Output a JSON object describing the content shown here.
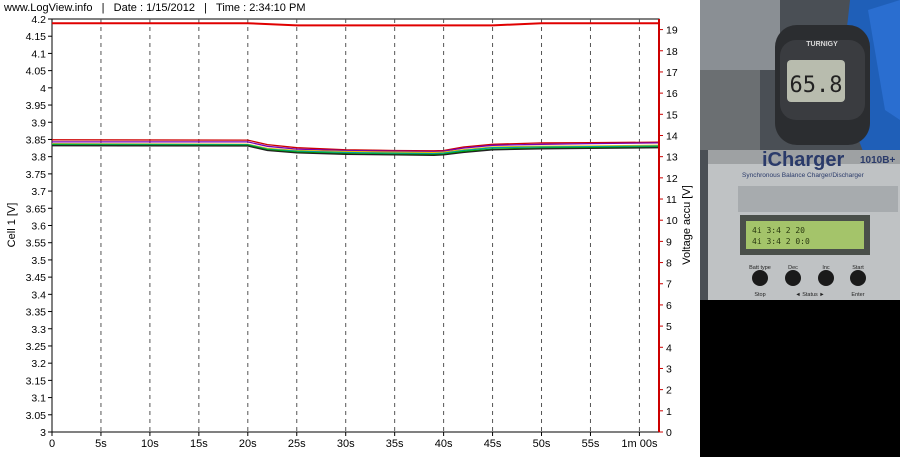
{
  "header": {
    "site": "www.LogView.info",
    "date": "Date : 1/15/2012",
    "time": "Time : 2:34:10 PM"
  },
  "photo": {
    "thermometer_brand": "TURNIGY",
    "thermometer_reading": "65.8",
    "charger_name": "iCharger",
    "charger_model": "1010B+",
    "charger_subtitle": "Synchronous Balance Charger/Discharger",
    "buttons": [
      "Batt type",
      "Dec",
      "Inc",
      "Start"
    ],
    "button_sublabels": [
      "Stop",
      "◄ Status ►",
      "Enter"
    ]
  },
  "chart_data": {
    "type": "line",
    "xlabel": "",
    "x_ticks": [
      "0",
      "5s",
      "10s",
      "15s",
      "20s",
      "25s",
      "30s",
      "35s",
      "40s",
      "45s",
      "50s",
      "55s",
      "1m 00s"
    ],
    "x_values": [
      0,
      5,
      10,
      15,
      20,
      25,
      30,
      35,
      40,
      45,
      50,
      55,
      60
    ],
    "xlim": [
      0,
      62
    ],
    "left_axis": {
      "label": "Cell 1 [V]",
      "ylim": [
        3.0,
        4.2
      ],
      "ticks": [
        "3",
        "3.05",
        "3.1",
        "3.15",
        "3.2",
        "3.25",
        "3.3",
        "3.35",
        "3.4",
        "3.45",
        "3.5",
        "3.55",
        "3.6",
        "3.65",
        "3.7",
        "3.75",
        "3.8",
        "3.85",
        "3.9",
        "3.95",
        "4",
        "4.05",
        "4.1",
        "4.15",
        "4.2"
      ]
    },
    "right_axis": {
      "label": "Voltage accu [V]",
      "ylim": [
        0,
        19.5
      ],
      "ticks": [
        "0",
        "1",
        "2",
        "3",
        "4",
        "5",
        "6",
        "7",
        "8",
        "9",
        "10",
        "11",
        "12",
        "13",
        "14",
        "15",
        "16",
        "17",
        "18",
        "19"
      ],
      "color": "#cc0000"
    },
    "grid": "vertical dashed",
    "series": [
      {
        "axis": "right",
        "color": "#e00000",
        "x": [
          0,
          20,
          25,
          30,
          35,
          40,
          45,
          50,
          55,
          62
        ],
        "y": [
          19.3,
          19.3,
          19.2,
          19.2,
          19.2,
          19.2,
          19.2,
          19.3,
          19.3,
          19.3
        ]
      },
      {
        "axis": "left",
        "color": "#cc0000",
        "x": [
          0,
          20,
          22,
          25,
          30,
          35,
          39,
          40,
          42,
          45,
          50,
          55,
          62
        ],
        "y": [
          3.849,
          3.848,
          3.835,
          3.826,
          3.82,
          3.818,
          3.817,
          3.818,
          3.828,
          3.836,
          3.84,
          3.841,
          3.842
        ]
      },
      {
        "axis": "left",
        "color": "#7a00b0",
        "x": [
          0,
          20,
          22,
          25,
          30,
          35,
          39,
          40,
          42,
          45,
          50,
          55,
          62
        ],
        "y": [
          3.843,
          3.843,
          3.83,
          3.822,
          3.818,
          3.816,
          3.815,
          3.816,
          3.825,
          3.833,
          3.836,
          3.838,
          3.84
        ]
      },
      {
        "axis": "left",
        "color": "#e8c000",
        "x": [
          0,
          20,
          22,
          25,
          30,
          35,
          39,
          40,
          42,
          45,
          50,
          55,
          62
        ],
        "y": [
          3.838,
          3.836,
          3.824,
          3.818,
          3.815,
          3.813,
          3.812,
          3.813,
          3.82,
          3.828,
          3.83,
          3.831,
          3.833
        ]
      },
      {
        "axis": "left",
        "color": "#00a0a0",
        "x": [
          0,
          20,
          22,
          25,
          30,
          35,
          39,
          40,
          42,
          45,
          50,
          55,
          62
        ],
        "y": [
          3.836,
          3.835,
          3.822,
          3.816,
          3.812,
          3.81,
          3.809,
          3.81,
          3.818,
          3.826,
          3.828,
          3.829,
          3.831
        ]
      },
      {
        "axis": "left",
        "color": "#00aa00",
        "x": [
          0,
          20,
          22,
          25,
          30,
          35,
          39,
          40,
          42,
          45,
          50,
          55,
          62
        ],
        "y": [
          3.834,
          3.833,
          3.82,
          3.813,
          3.809,
          3.807,
          3.806,
          3.807,
          3.815,
          3.822,
          3.825,
          3.826,
          3.828
        ]
      },
      {
        "axis": "left",
        "color": "#222222",
        "x": [
          0,
          20,
          22,
          25,
          30,
          35,
          39,
          40,
          42,
          45,
          50,
          55,
          62
        ],
        "y": [
          3.832,
          3.831,
          3.818,
          3.811,
          3.807,
          3.805,
          3.804,
          3.805,
          3.812,
          3.82,
          3.823,
          3.824,
          3.826
        ]
      }
    ]
  }
}
